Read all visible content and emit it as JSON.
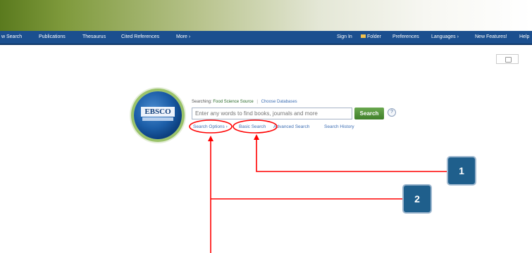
{
  "nav": {
    "left": [
      "w Search",
      "Publications",
      "Thesaurus",
      "Cited References",
      "More ›"
    ],
    "right": [
      "Sign In",
      "Folder",
      "Preferences",
      "Languages ›",
      "New Features!",
      "Help"
    ]
  },
  "search": {
    "searching_label": "Searching:",
    "database": "Food Science Source",
    "choose_databases": "Choose Databases",
    "placeholder": "Enter any words to find books, journals and more",
    "button": "Search",
    "help": "?"
  },
  "logo": {
    "text": "EBSCO"
  },
  "links": [
    "Search Options ›",
    "Basic Search",
    "Advanced Search",
    "Search History"
  ],
  "annotations": {
    "callout1": "1",
    "callout2": "2",
    "color": "#ff0000"
  }
}
